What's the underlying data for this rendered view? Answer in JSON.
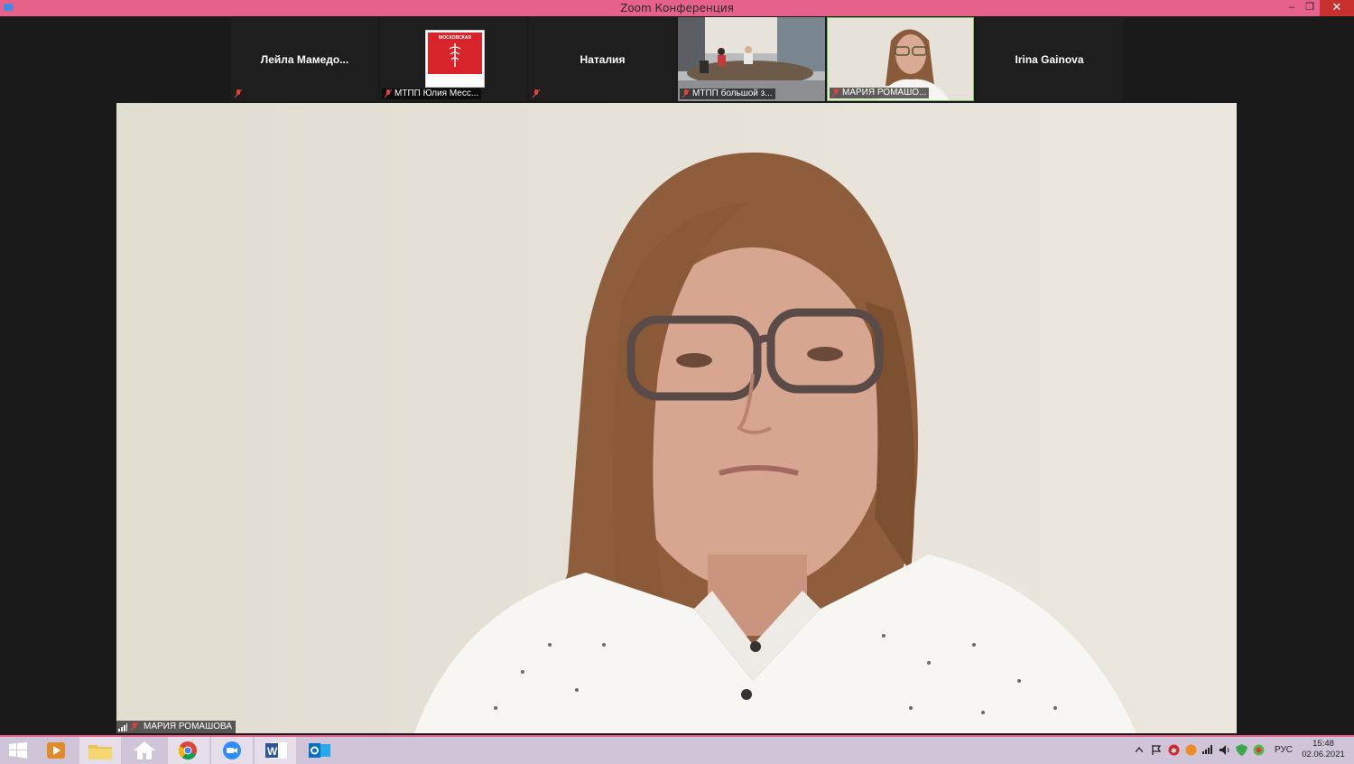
{
  "window": {
    "title": "Zoom Конференция",
    "minimize_label": "–",
    "maximize_label": "❐",
    "close_label": "✕"
  },
  "gallery": [
    {
      "name": "Лейла  Мамедо...",
      "footer": "",
      "type": "name-only"
    },
    {
      "name": "",
      "footer": "МТПП Юлия Месс...",
      "type": "logo",
      "logo_text": "МОСКОВСКАЯ"
    },
    {
      "name": "Наталия",
      "footer": "",
      "type": "name-only"
    },
    {
      "name": "",
      "footer": "МТПП большой з...",
      "type": "video"
    },
    {
      "name": "",
      "footer": "МАРИЯ РОМАШО...",
      "type": "video",
      "active": true
    },
    {
      "name": "Irina Gainova",
      "footer": "",
      "type": "name-only"
    }
  ],
  "main": {
    "speaker": "МАРИЯ РОМАШОВА"
  },
  "taskbar": {
    "language": "РУС",
    "time": "15:48",
    "date": "02.06.2021",
    "apps": [
      "windows-start",
      "media-player",
      "file-explorer",
      "home",
      "chrome",
      "zoom",
      "word",
      "outlook"
    ]
  },
  "colors": {
    "accent": "#e6628a",
    "close": "#c8312b",
    "active_border": "#76c25a"
  }
}
